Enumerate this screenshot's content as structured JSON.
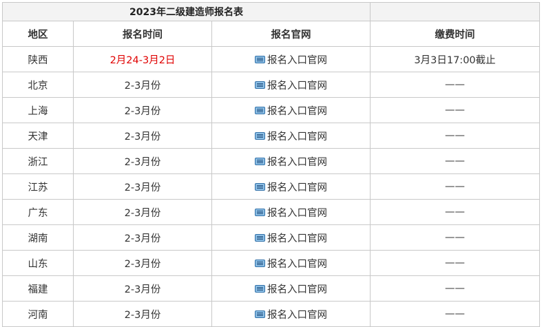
{
  "table": {
    "title": "2023年二级建造师报名表",
    "headers": [
      "地区",
      "报名时间",
      "报名官网",
      "缴费时间"
    ],
    "rows": [
      {
        "region": "陕西",
        "time": "2月24-3月2日",
        "time_highlight": true,
        "site": "报名入口官网",
        "fee": "3月3日17:00截止"
      },
      {
        "region": "北京",
        "time": "2-3月份",
        "time_highlight": false,
        "site": "报名入口官网",
        "fee": "——"
      },
      {
        "region": "上海",
        "time": "2-3月份",
        "time_highlight": false,
        "site": "报名入口官网",
        "fee": "——"
      },
      {
        "region": "天津",
        "time": "2-3月份",
        "time_highlight": false,
        "site": "报名入口官网",
        "fee": "——"
      },
      {
        "region": "浙江",
        "time": "2-3月份",
        "time_highlight": false,
        "site": "报名入口官网",
        "fee": "——"
      },
      {
        "region": "江苏",
        "time": "2-3月份",
        "time_highlight": false,
        "site": "报名入口官网",
        "fee": "——"
      },
      {
        "region": "广东",
        "time": "2-3月份",
        "time_highlight": false,
        "site": "报名入口官网",
        "fee": "——"
      },
      {
        "region": "湖南",
        "time": "2-3月份",
        "time_highlight": false,
        "site": "报名入口官网",
        "fee": "——"
      },
      {
        "region": "山东",
        "time": "2-3月份",
        "time_highlight": false,
        "site": "报名入口官网",
        "fee": "——"
      },
      {
        "region": "福建",
        "time": "2-3月份",
        "time_highlight": false,
        "site": "报名入口官网",
        "fee": "——"
      },
      {
        "region": "河南",
        "time": "2-3月份",
        "time_highlight": false,
        "site": "报名入口官网",
        "fee": "——"
      }
    ]
  },
  "colors": {
    "highlight": "#e00000",
    "border": "#c8c8c8",
    "title_bg": "#f3f3f3"
  },
  "icons": {
    "site_link": "keyboard-icon"
  }
}
